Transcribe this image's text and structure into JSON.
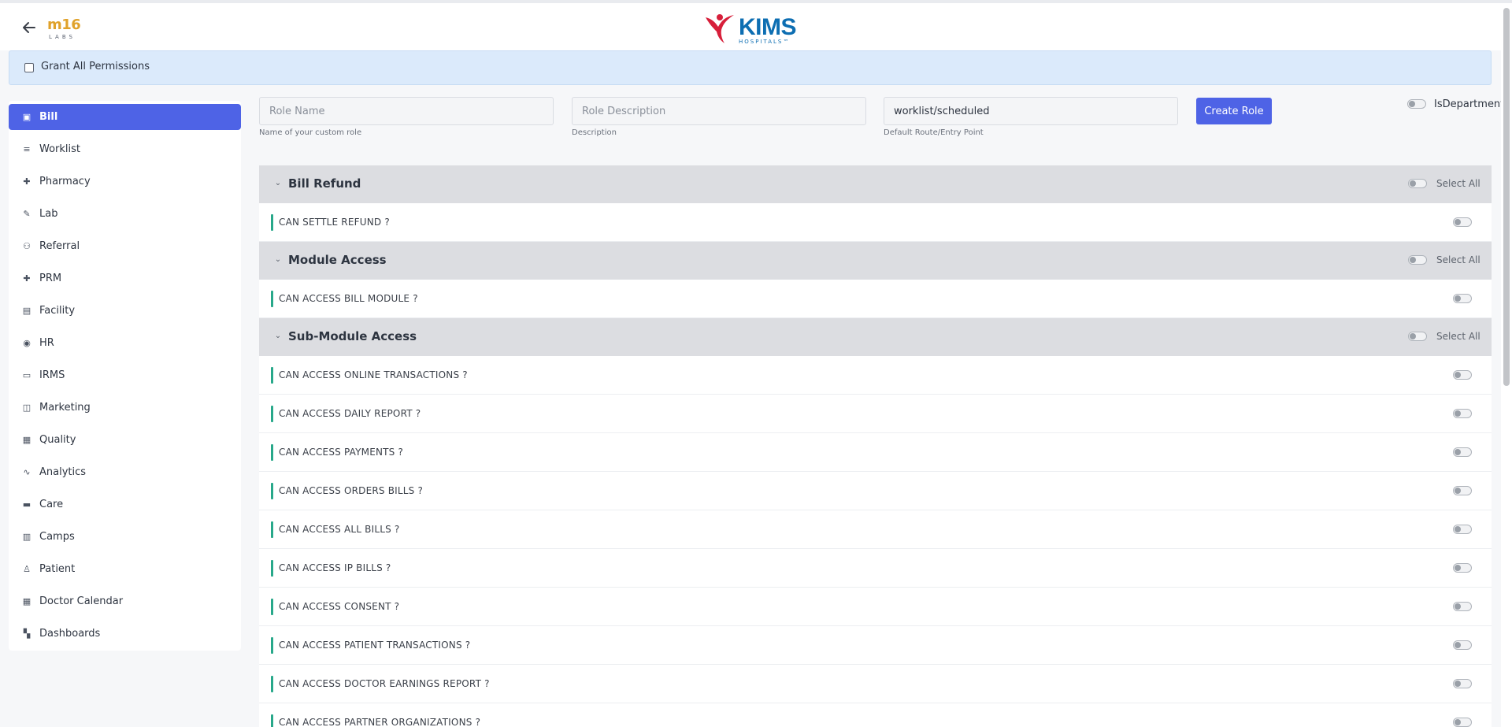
{
  "header": {
    "brand_main": "m16",
    "brand_sub": "LABS",
    "hospital_name": "KIMS",
    "hospital_sub": "HOSPITALS™"
  },
  "grant_all": {
    "label": "Grant All Permissions",
    "checked": false
  },
  "sidebar": {
    "items": [
      {
        "label": "Bill",
        "icon": "bill-icon",
        "active": true
      },
      {
        "label": "Worklist",
        "icon": "list-icon",
        "active": false
      },
      {
        "label": "Pharmacy",
        "icon": "plus-icon",
        "active": false
      },
      {
        "label": "Lab",
        "icon": "pipette-icon",
        "active": false
      },
      {
        "label": "Referral",
        "icon": "users-icon",
        "active": false
      },
      {
        "label": "PRM",
        "icon": "plus-icon",
        "active": false
      },
      {
        "label": "Facility",
        "icon": "building-icon",
        "active": false
      },
      {
        "label": "HR",
        "icon": "user-circle-icon",
        "active": false
      },
      {
        "label": "IRMS",
        "icon": "id-card-icon",
        "active": false
      },
      {
        "label": "Marketing",
        "icon": "bag-icon",
        "active": false
      },
      {
        "label": "Quality",
        "icon": "badge-icon",
        "active": false
      },
      {
        "label": "Analytics",
        "icon": "activity-icon",
        "active": false
      },
      {
        "label": "Care",
        "icon": "bed-icon",
        "active": false
      },
      {
        "label": "Camps",
        "icon": "briefcase-icon",
        "active": false
      },
      {
        "label": "Patient",
        "icon": "user-icon",
        "active": false
      },
      {
        "label": "Doctor Calendar",
        "icon": "calendar-icon",
        "active": false
      },
      {
        "label": "Dashboards",
        "icon": "grid-icon",
        "active": false
      }
    ]
  },
  "form": {
    "role_name": {
      "placeholder": "Role Name",
      "value": "",
      "help": "Name of your custom role"
    },
    "role_description": {
      "placeholder": "Role Description",
      "value": "",
      "help": "Description"
    },
    "default_route": {
      "placeholder": "",
      "value": "worklist/scheduled",
      "help": "Default Route/Entry Point"
    },
    "create_button": "Create Role",
    "is_department_label": "IsDepartment",
    "is_department_on": false
  },
  "select_all_label": "Select All",
  "sections": [
    {
      "title": "Bill Refund",
      "permissions": [
        "CAN SETTLE REFUND ?"
      ]
    },
    {
      "title": "Module Access",
      "permissions": [
        "CAN ACCESS BILL MODULE ?"
      ]
    },
    {
      "title": "Sub-Module Access",
      "permissions": [
        "CAN ACCESS ONLINE TRANSACTIONS ?",
        "CAN ACCESS DAILY REPORT ?",
        "CAN ACCESS PAYMENTS ?",
        "CAN ACCESS ORDERS BILLS ?",
        "CAN ACCESS ALL BILLS ?",
        "CAN ACCESS IP BILLS ?",
        "CAN ACCESS CONSENT ?",
        "CAN ACCESS PATIENT TRANSACTIONS ?",
        "CAN ACCESS DOCTOR EARNINGS REPORT ?",
        "CAN ACCESS PARTNER ORGANIZATIONS ?"
      ]
    }
  ],
  "colors": {
    "primary": "#4e63e6",
    "grant_bg": "#dbeafb",
    "section_bg": "#dcdde1",
    "permission_accent": "#28a88a",
    "logo_blue": "#0d6eb2",
    "logo_red": "#d71f3a"
  }
}
